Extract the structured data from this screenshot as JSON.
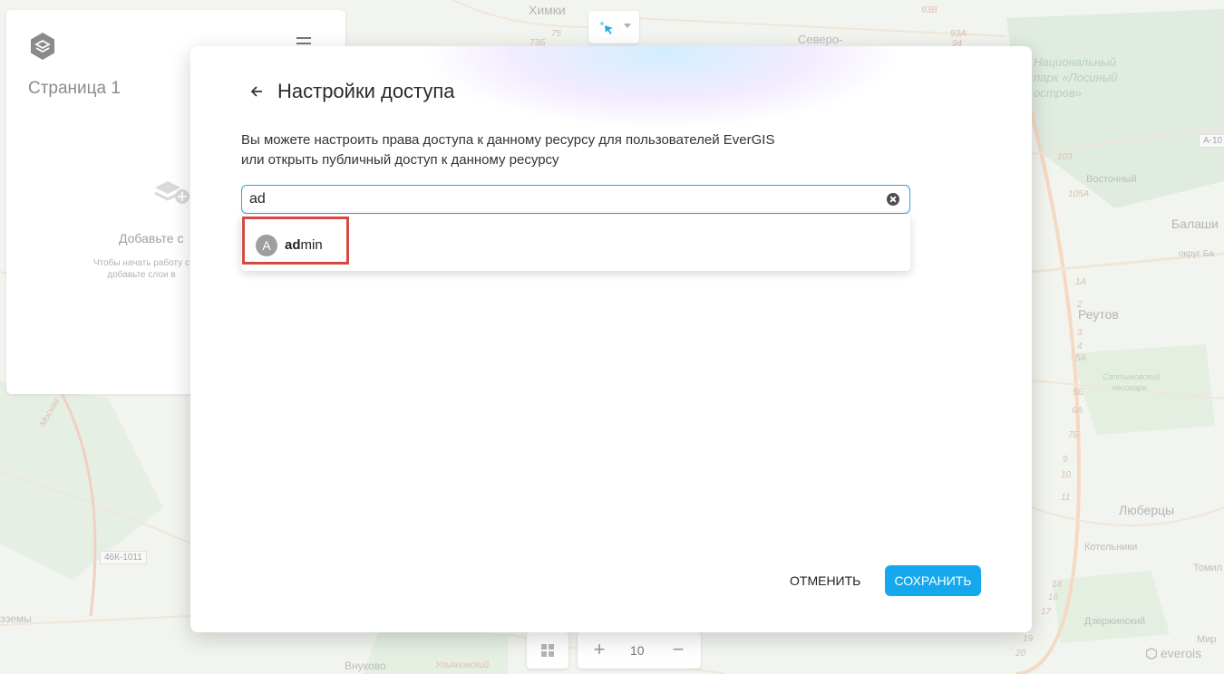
{
  "colors": {
    "accent": "#16a8ee",
    "input_border": "#29a8d9",
    "highlight": "#d54b43",
    "avatar_bg": "#9e9e9e"
  },
  "map": {
    "labels": {
      "khimki": "Химки",
      "severo": "Северо-",
      "natsionalny": "Национальный",
      "park_losiny": "парк «Лосиный",
      "ostrov": "остров»",
      "vostochny": "Восточный",
      "balashikha": "Балаши",
      "okrug_ba": "округ Ба",
      "reutov": "Реутов",
      "saltykovsky": "Салтыковский",
      "lesopark": "лесопарк",
      "lyubertsy": "Люберцы",
      "kotelniki": "Котельники",
      "tomil": "Томил",
      "dzerzhinsky": "Дзержинский",
      "mir": "Мир",
      "vnukovo": "Внуково",
      "ulyanovsky": "Ульяновский",
      "izmy": "эземы",
      "moskva": "Москва"
    },
    "shields": {
      "a10": "А-10",
      "r46k": "46К-1011"
    },
    "road_numbers": [
      "93В",
      "93А",
      "75",
      "73Б",
      "94",
      "103",
      "105А",
      "1А",
      "2",
      "3",
      "4",
      "5А",
      "5Б",
      "6А",
      "7Б",
      "9",
      "10",
      "11",
      "14",
      "16",
      "17",
      "19",
      "20"
    ]
  },
  "left_panel": {
    "page_title": "Страница 1",
    "empty_title": "Добавьте с",
    "empty_desc_line1": "Чтобы начать работу с",
    "empty_desc_line2": "добавьте слои в"
  },
  "bottom": {
    "zoom_plus": "+",
    "zoom_level": "10",
    "zoom_minus": "−",
    "brand": "everois"
  },
  "modal": {
    "title": "Настройки доступа",
    "description_line1": "Вы можете настроить права доступа к данному ресурсу для пользователей EverGIS",
    "description_line2": "или открыть публичный доступ к данному ресурсу",
    "search": {
      "value": "ad",
      "placeholder": ""
    },
    "suggestions": [
      {
        "avatar_letter": "A",
        "match": "ad",
        "rest": "min"
      }
    ],
    "cancel_label": "Отменить",
    "save_label": "Сохранить"
  }
}
